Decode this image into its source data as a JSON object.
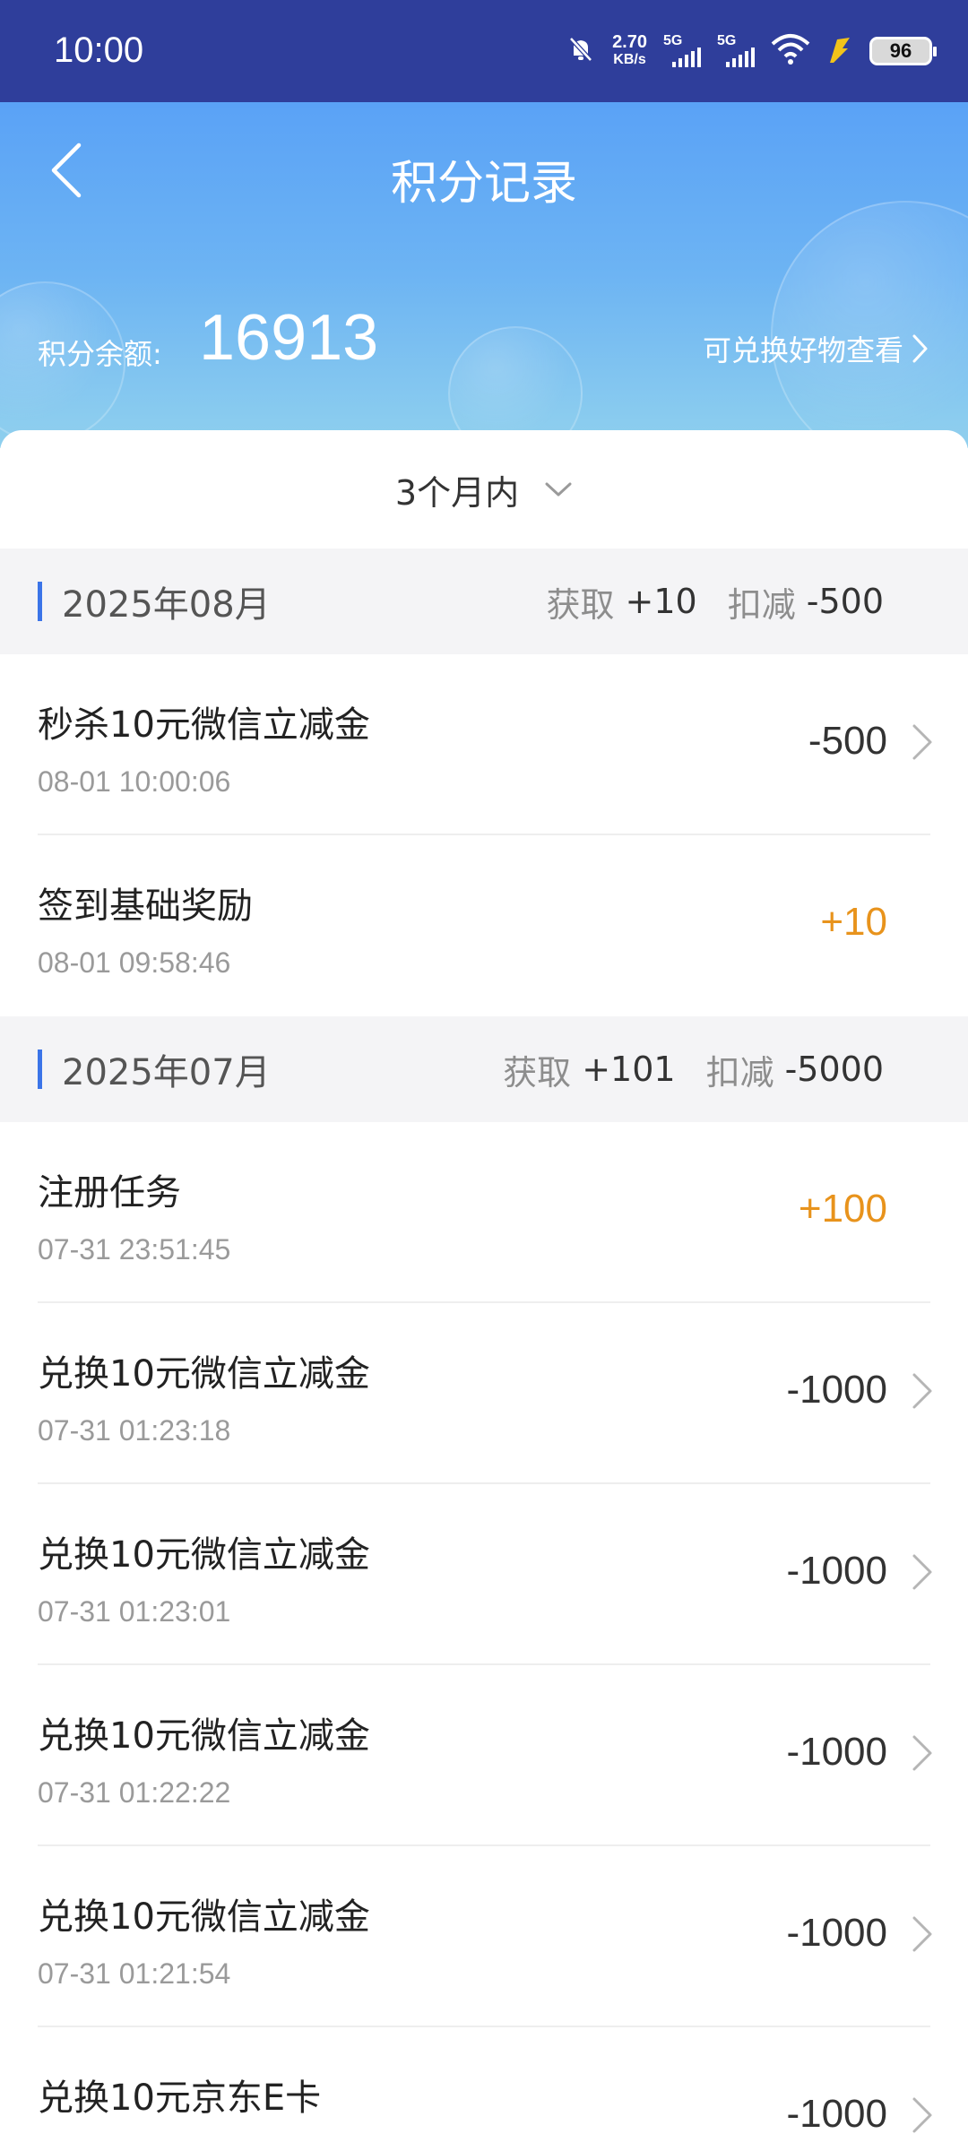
{
  "status_bar": {
    "time": "10:00",
    "net_speed_value": "2.70",
    "net_speed_unit": "KB/s",
    "signal_1_label": "5G",
    "signal_2_label": "5G",
    "battery": "96",
    "icons": [
      "mute-bell-icon",
      "signal-icon",
      "signal-icon",
      "wifi-icon",
      "charging-icon",
      "battery-icon"
    ]
  },
  "header": {
    "title": "积分记录",
    "balance_label": "积分余额:",
    "balance_value": "16913",
    "redeem_link": "可兑换好物查看"
  },
  "filter": {
    "selected": "3个月内"
  },
  "colors": {
    "status_bar": "#2f3e9b",
    "header_gradient_top": "#5aa2f6",
    "accent_bar": "#3b74e8",
    "plus_amount": "#e8931c"
  },
  "months": [
    {
      "title": "2025年08月",
      "earn_label": "获取",
      "earn_value": "+10",
      "deduct_label": "扣减",
      "deduct_value": "-500",
      "records": [
        {
          "title": "秒杀10元微信立减金",
          "time": "08-01 10:00:06",
          "amount": "-500"
        },
        {
          "title": "签到基础奖励",
          "time": "08-01 09:58:46",
          "amount": "+10"
        }
      ]
    },
    {
      "title": "2025年07月",
      "earn_label": "获取",
      "earn_value": "+101",
      "deduct_label": "扣减",
      "deduct_value": "-5000",
      "records": [
        {
          "title": "注册任务",
          "time": "07-31 23:51:45",
          "amount": "+100"
        },
        {
          "title": "兑换10元微信立减金",
          "time": "07-31 01:23:18",
          "amount": "-1000"
        },
        {
          "title": "兑换10元微信立减金",
          "time": "07-31 01:23:01",
          "amount": "-1000"
        },
        {
          "title": "兑换10元微信立减金",
          "time": "07-31 01:22:22",
          "amount": "-1000"
        },
        {
          "title": "兑换10元微信立减金",
          "time": "07-31 01:21:54",
          "amount": "-1000"
        },
        {
          "title": "兑换10元京东E卡",
          "time": "",
          "amount": "-1000"
        }
      ]
    }
  ]
}
